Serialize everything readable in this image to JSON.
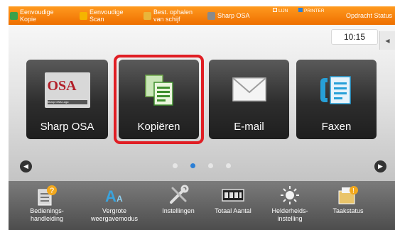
{
  "topbar": {
    "items": [
      {
        "label": "Eenvoudige\nKopie",
        "icon": "copy-icon",
        "color": "#3aa14a"
      },
      {
        "label": "Eenvoudige\nScan",
        "icon": "scan-icon",
        "color": "#f5b400"
      },
      {
        "label": "Best. ophalen\nvan schijf",
        "icon": "folder-icon",
        "color": "#e9b53a"
      },
      {
        "label": "Sharp OSA",
        "icon": "osa-icon",
        "color": "#8a8a8a"
      }
    ],
    "line_indicator": "LIJN",
    "printer_indicator": "PRINTER",
    "status_label": "Opdracht Status"
  },
  "clock": "10:15",
  "tiles": [
    {
      "label": "Sharp OSA",
      "icon": "sharp-osa-logo"
    },
    {
      "label": "Kopiëren",
      "icon": "copy-documents-icon"
    },
    {
      "label": "E-mail",
      "icon": "envelope-icon"
    },
    {
      "label": "Faxen",
      "icon": "fax-document-icon"
    }
  ],
  "osa_logo": {
    "text": "OSA",
    "subtitle": "Sharp OSA Logo"
  },
  "pager": {
    "pages": 4,
    "active": 2
  },
  "bottombar": {
    "items": [
      {
        "label": "Bedienings-\nhandleiding",
        "icon": "manual-help-icon"
      },
      {
        "label": "Vergrote\nweergavemodus",
        "icon": "enlarge-text-icon"
      },
      {
        "label": "Instellingen",
        "icon": "tools-icon"
      },
      {
        "label": "Totaal Aantal",
        "icon": "counter-icon"
      },
      {
        "label": "Helderheids-\ninstelling",
        "icon": "brightness-icon"
      },
      {
        "label": "Taakstatus",
        "icon": "job-status-icon"
      }
    ]
  },
  "colors": {
    "accent": "#ee6f00",
    "highlight": "#e01e24",
    "pager_active": "#2b7fd6"
  }
}
